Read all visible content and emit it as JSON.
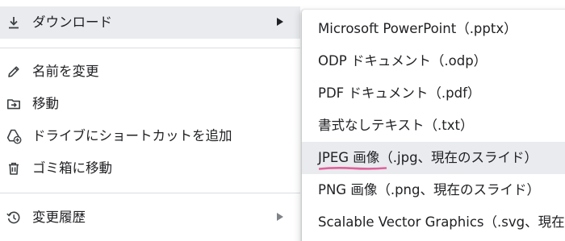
{
  "menu": {
    "items": [
      {
        "label": "ダウンロード",
        "icon": "download-icon",
        "has_submenu": true,
        "hovered": true
      },
      {
        "label": "名前を変更",
        "icon": "pencil-icon"
      },
      {
        "label": "移動",
        "icon": "move-to-folder-icon"
      },
      {
        "label": "ドライブにショートカットを追加",
        "icon": "add-shortcut-icon"
      },
      {
        "label": "ゴミ箱に移動",
        "icon": "trash-icon"
      },
      {
        "label": "変更履歴",
        "icon": "history-icon",
        "has_submenu": true
      }
    ]
  },
  "submenu": {
    "items": [
      {
        "label": "Microsoft PowerPoint（.pptx）"
      },
      {
        "label": "ODP ドキュメント（.odp）"
      },
      {
        "label": "PDF ドキュメント（.pdf）"
      },
      {
        "label": "書式なしテキスト（.txt）"
      },
      {
        "label": "JPEG 画像（.jpg、現在のスライド）",
        "hovered": true
      },
      {
        "label": "PNG 画像（.png、現在のスライド）"
      },
      {
        "label": "Scalable Vector Graphics（.svg、現在のスライド）"
      }
    ]
  },
  "colors": {
    "hover_bg": "#e9ebee",
    "text": "#202124",
    "icon": "#3c4043",
    "divider": "#dadce0",
    "annotation_underline": "#e0609a"
  }
}
